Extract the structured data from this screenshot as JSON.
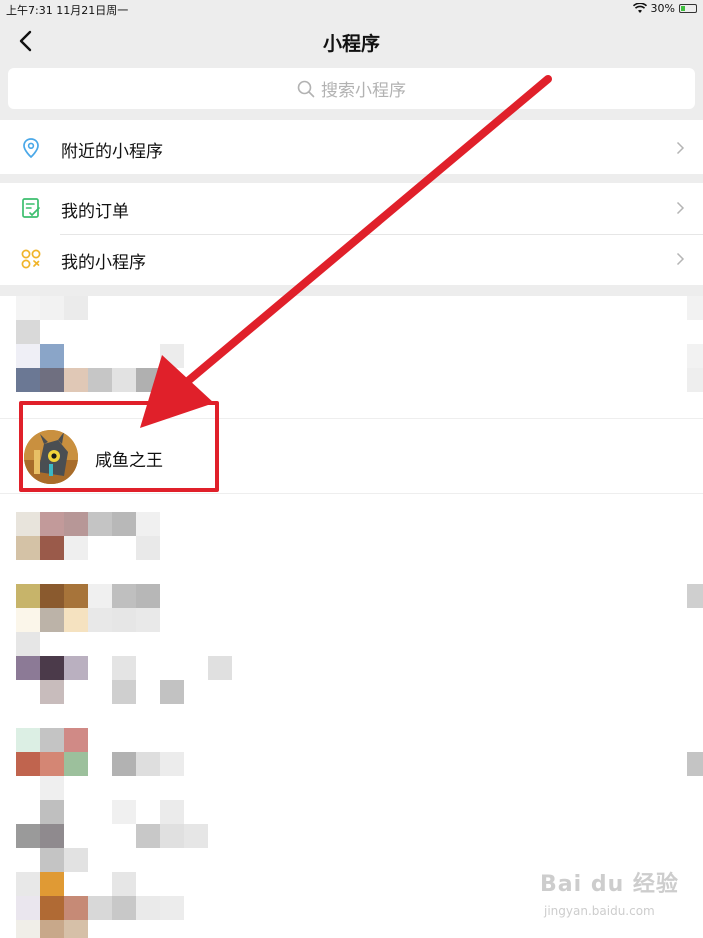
{
  "status_bar": {
    "time_date": "上午7:31   11月21日周一",
    "battery_percent": "30%",
    "battery_level": 0.3
  },
  "nav": {
    "title": "小程序",
    "back_icon": "chevron-left-icon"
  },
  "search": {
    "placeholder": "搜索小程序",
    "icon": "search-icon"
  },
  "menu": {
    "nearby": {
      "label": "附近的小程序",
      "icon": "location-pin-icon",
      "icon_color": "#4aa8e8"
    },
    "orders": {
      "label": "我的订单",
      "icon": "order-list-icon",
      "icon_color": "#3cbf6e"
    },
    "my_apps": {
      "label": "我的小程序",
      "icon": "mini-program-icon",
      "icon_color": "#f0b429"
    }
  },
  "list": {
    "highlighted_app": {
      "name": "咸鱼之王",
      "icon": "app-avatar"
    }
  },
  "annotation": {
    "arrow_color": "#e0202a",
    "box_color": "#e0202a"
  },
  "watermark": {
    "logo": "Bai du 经验",
    "sub": "jingyan.baidu.com"
  }
}
